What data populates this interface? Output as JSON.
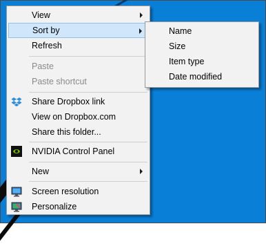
{
  "context_menu": {
    "items": [
      {
        "label": "View"
      },
      {
        "label": "Sort by"
      },
      {
        "label": "Refresh"
      },
      {
        "label": "Paste"
      },
      {
        "label": "Paste shortcut"
      },
      {
        "label": "Share Dropbox link"
      },
      {
        "label": "View on Dropbox.com"
      },
      {
        "label": "Share this folder..."
      },
      {
        "label": "NVIDIA Control Panel"
      },
      {
        "label": "New"
      },
      {
        "label": "Screen resolution"
      },
      {
        "label": "Personalize"
      }
    ]
  },
  "submenu": {
    "items": [
      {
        "label": "Name"
      },
      {
        "label": "Size"
      },
      {
        "label": "Item type"
      },
      {
        "label": "Date modified"
      }
    ]
  },
  "colors": {
    "desktop": "#0a7fd8",
    "menu_bg": "#f2f2f2",
    "highlight": "#cfe6fb"
  },
  "icons": [
    "dropbox-icon",
    "nvidia-icon",
    "screen-resolution-icon",
    "personalize-icon"
  ]
}
